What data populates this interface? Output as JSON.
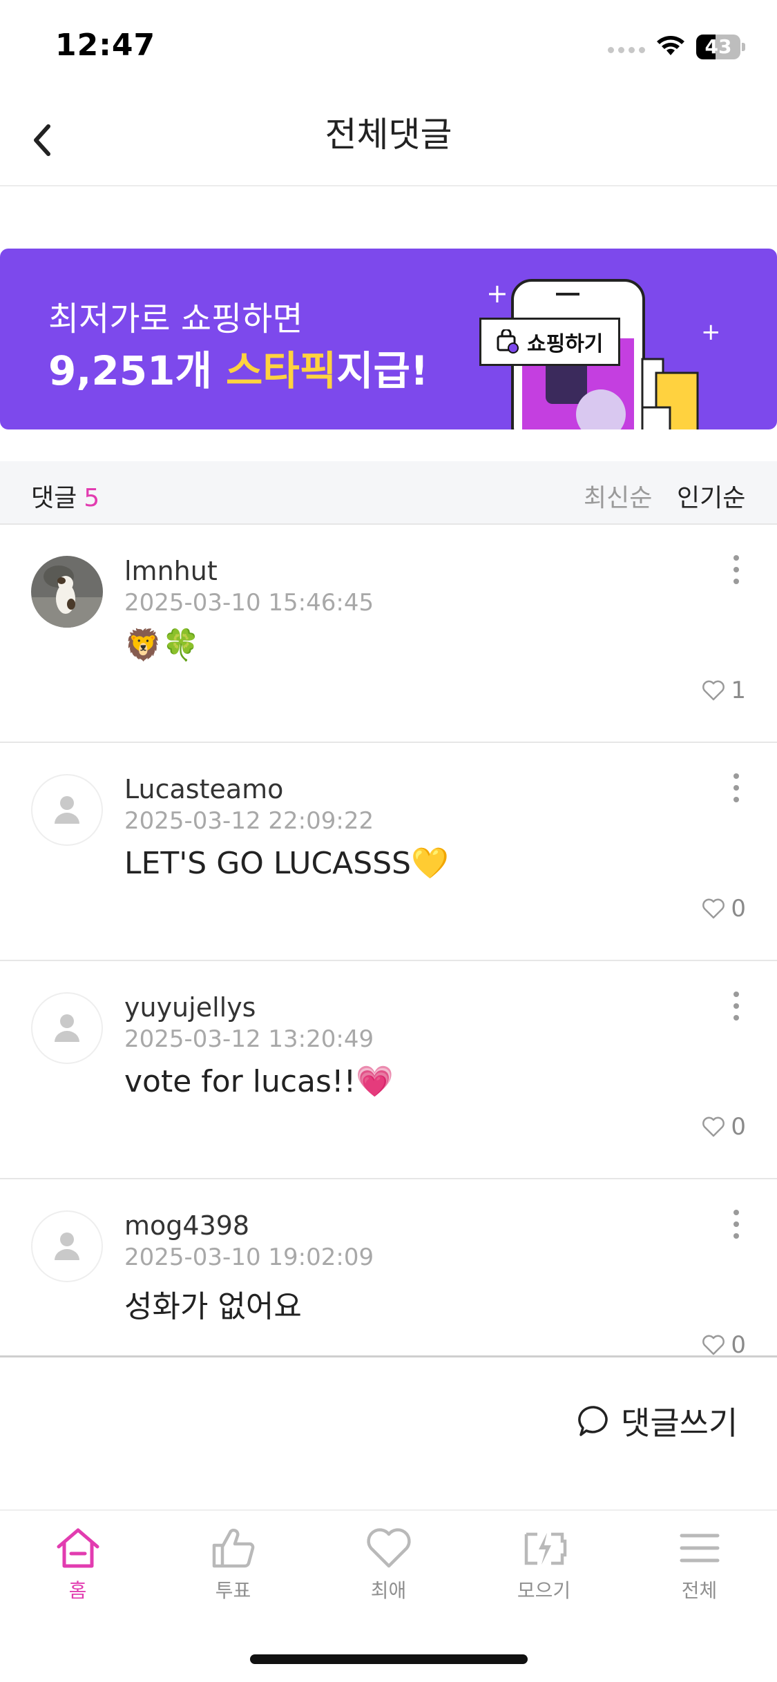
{
  "status_bar": {
    "time": "12:47",
    "battery": "43",
    "battery_level": 0.43
  },
  "nav": {
    "title": "전체댓글"
  },
  "banner": {
    "line1": "최저가로 쇼핑하면",
    "line2_count": "9,251개 ",
    "line2_highlight": "스타픽",
    "line2_suffix": "지급!",
    "chip_label": "쇼핑하기",
    "background": "#7d49ec",
    "highlight_color": "#ffd23f"
  },
  "comments_header": {
    "label": "댓글",
    "count": "5",
    "sort_latest": "최신순",
    "sort_popular": "인기순"
  },
  "comments": [
    {
      "username": "lmnhut",
      "timestamp": "2025-03-10 15:46:45",
      "text": "🦁🍀",
      "likes": "1",
      "avatar": "photo"
    },
    {
      "username": "Lucasteamo",
      "timestamp": "2025-03-12 22:09:22",
      "text": "LET'S GO LUCASSS💛",
      "likes": "0",
      "avatar": "placeholder"
    },
    {
      "username": "yuyujellys",
      "timestamp": "2025-03-12 13:20:49",
      "text": "vote for lucas!!💗",
      "likes": "0",
      "avatar": "placeholder"
    },
    {
      "username": "mog4398",
      "timestamp": "2025-03-10 19:02:09",
      "text": "성화가 없어요",
      "likes": "0",
      "avatar": "placeholder"
    }
  ],
  "write_comment": {
    "label": "댓글쓰기"
  },
  "tab_bar": {
    "accent": "#e23cb0",
    "tabs": [
      {
        "label": "홈",
        "icon": "home-icon",
        "active": true
      },
      {
        "label": "투표",
        "icon": "thumbs-up-icon",
        "active": false
      },
      {
        "label": "최애",
        "icon": "heart-icon",
        "active": false
      },
      {
        "label": "모으기",
        "icon": "charge-icon",
        "active": false
      },
      {
        "label": "전체",
        "icon": "menu-icon",
        "active": false
      }
    ]
  }
}
